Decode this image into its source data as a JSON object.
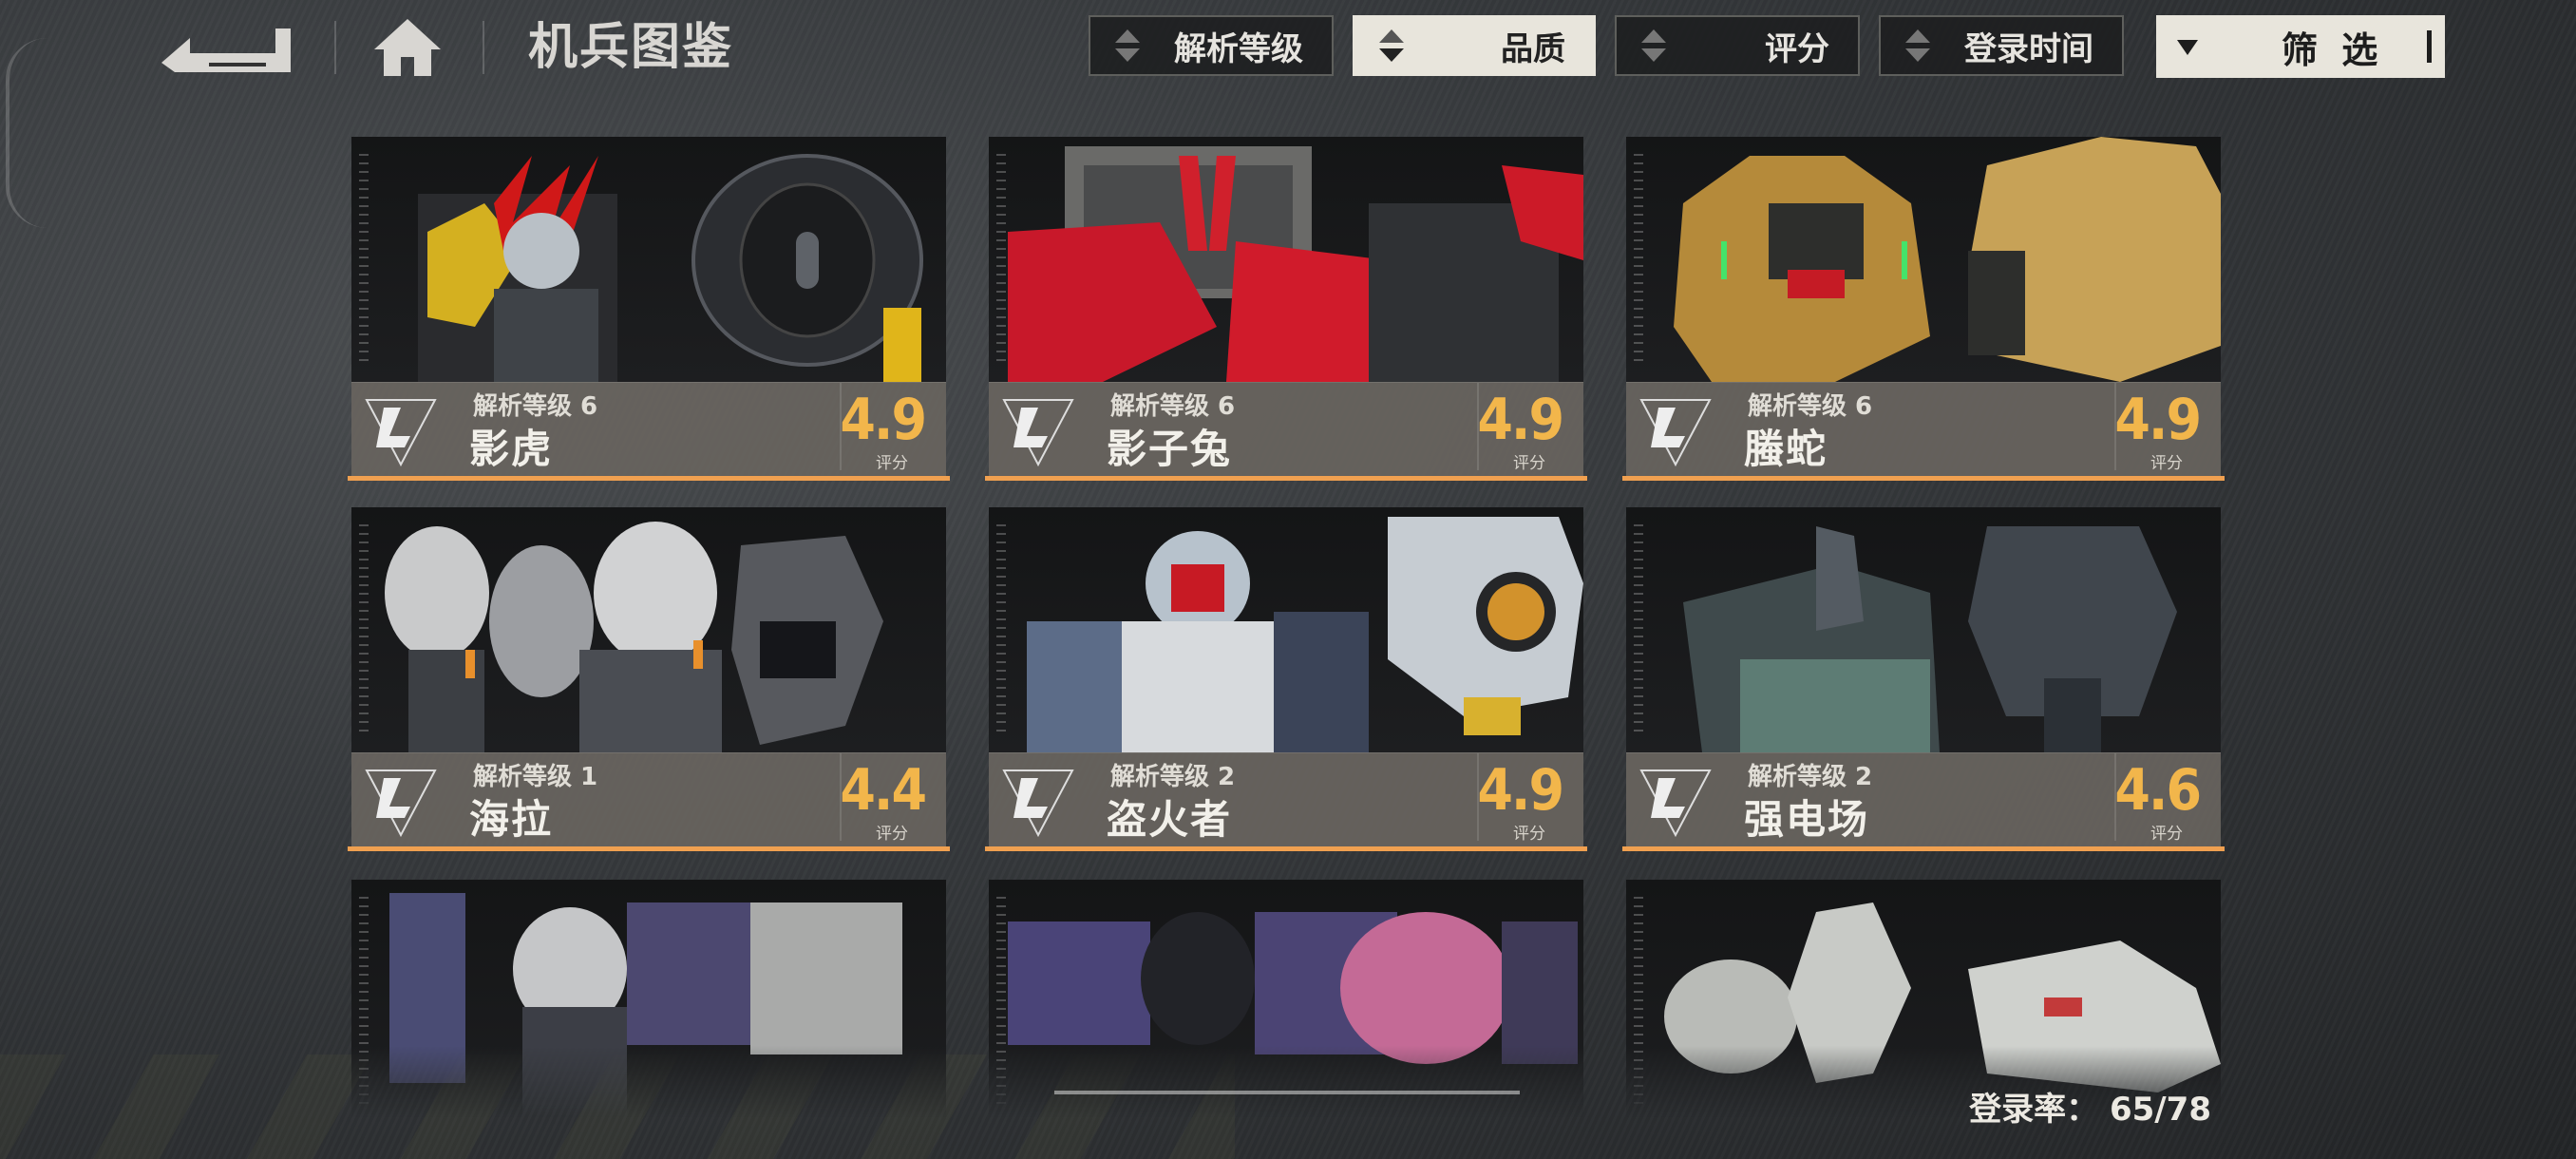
{
  "header": {
    "title": "机兵图鉴",
    "sort_buttons": [
      {
        "label": "解析等级",
        "active": false
      },
      {
        "label": "品质",
        "active": true
      },
      {
        "label": "评分",
        "active": false
      },
      {
        "label": "登录时间",
        "active": false
      }
    ],
    "filter_label": "筛 选"
  },
  "cards": [
    {
      "level": "解析等级 6",
      "name": "影虎",
      "score": "4.9",
      "score_label": "评分"
    },
    {
      "level": "解析等级 6",
      "name": "影子兔",
      "score": "4.9",
      "score_label": "评分"
    },
    {
      "level": "解析等级 6",
      "name": "螣蛇",
      "score": "4.9",
      "score_label": "评分"
    },
    {
      "level": "解析等级 1",
      "name": "海拉",
      "score": "4.4",
      "score_label": "评分"
    },
    {
      "level": "解析等级 2",
      "name": "盗火者",
      "score": "4.9",
      "score_label": "评分"
    },
    {
      "level": "解析等级 2",
      "name": "强电场",
      "score": "4.6",
      "score_label": "评分"
    }
  ],
  "footer": {
    "collection_label": "登录率：",
    "collection_value": "65/78"
  },
  "colors": {
    "accent_orange": "#f0a050",
    "score_gold": "#f2b64b",
    "active_button_bg": "#e8e5dc"
  },
  "icons": [
    "back-arrow-icon",
    "home-icon",
    "sort-arrows-icon",
    "chevron-down-icon",
    "mech-badge-icon"
  ]
}
